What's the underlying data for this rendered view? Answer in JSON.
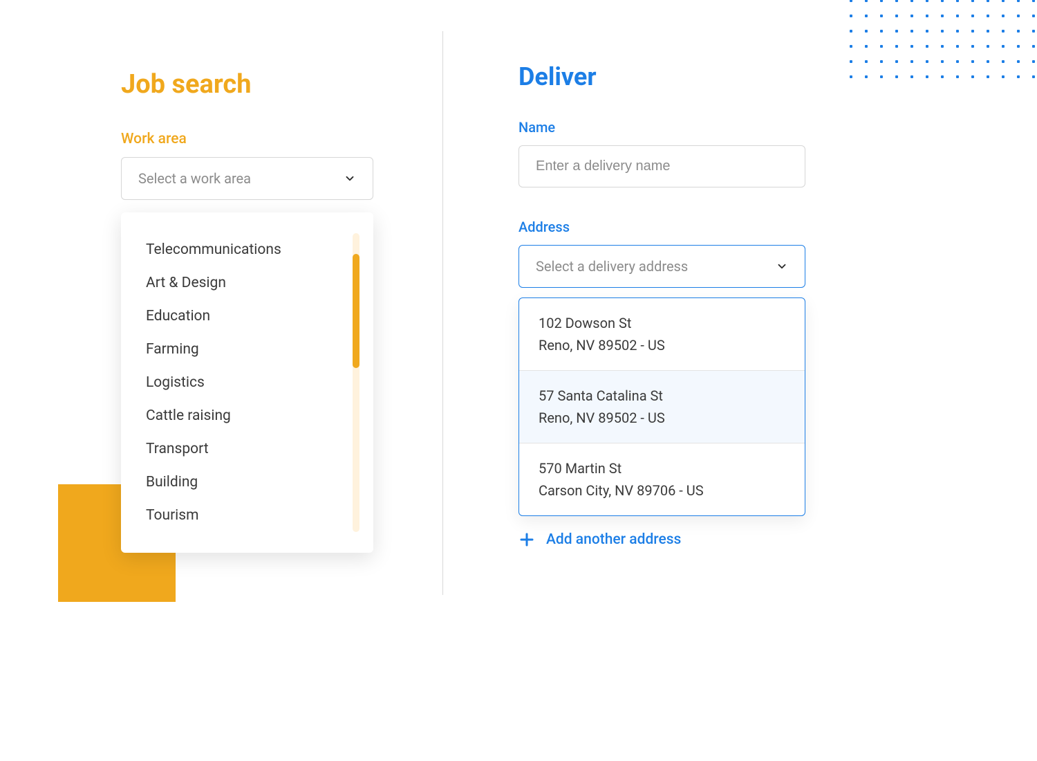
{
  "left": {
    "title": "Job search",
    "work_area_label": "Work area",
    "select_placeholder": "Select a work area",
    "options": [
      "Telecommunications",
      "Art & Design",
      "Education",
      "Farming",
      "Logistics",
      "Cattle raising",
      "Transport",
      "Building",
      "Tourism"
    ]
  },
  "right": {
    "title": "Deliver",
    "name_label": "Name",
    "name_placeholder": "Enter a delivery name",
    "address_label": "Address",
    "address_placeholder": "Select a delivery address",
    "addresses": [
      {
        "line1": "102 Dowson St",
        "line2": "Reno, NV 89502 - US",
        "hover": false
      },
      {
        "line1": "57 Santa Catalina St",
        "line2": "Reno, NV 89502 - US",
        "hover": true
      },
      {
        "line1": "570 Martin St",
        "line2": "Carson City, NV 89706 - US",
        "hover": false
      }
    ],
    "add_address_label": "Add another address"
  }
}
